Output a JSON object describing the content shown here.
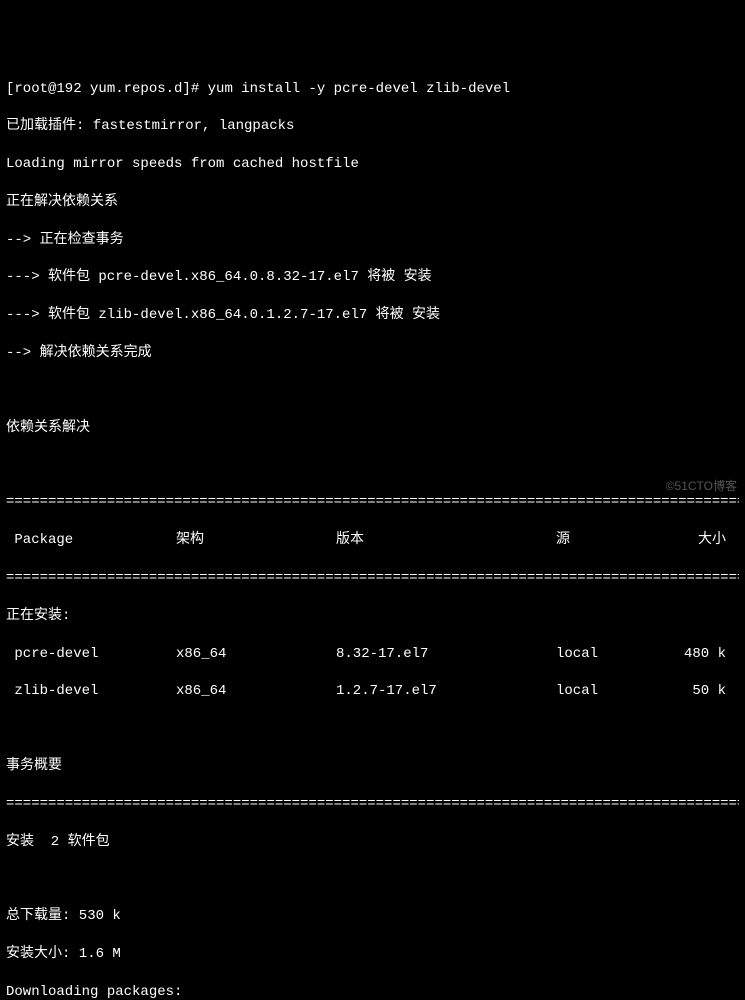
{
  "prompt": {
    "user_host": "[root@192 yum.repos.d]#",
    "command": "yum install -y pcre-devel zlib-devel"
  },
  "output": {
    "plugins": "已加载插件: fastestmirror, langpacks",
    "loading": "Loading mirror speeds from cached hostfile",
    "resolving": "正在解决依赖关系",
    "check_tx": "--> 正在检查事务",
    "pkg1": "---> 软件包 pcre-devel.x86_64.0.8.32-17.el7 将被 安装",
    "pkg2": "---> 软件包 zlib-devel.x86_64.0.1.2.7-17.el7 将被 安装",
    "done": "--> 解决依赖关系完成",
    "resolved": "依赖关系解决"
  },
  "divider": "=========================================================================================",
  "headers": {
    "package": " Package",
    "arch": "架构",
    "version": "版本",
    "repo": "源",
    "size": "大小"
  },
  "installing_label": "正在安装:",
  "rows": [
    {
      "package": " pcre-devel",
      "arch": "x86_64",
      "version": "8.32-17.el7",
      "repo": "local",
      "size": "480 k"
    },
    {
      "package": " zlib-devel",
      "arch": "x86_64",
      "version": "1.2.7-17.el7",
      "repo": "local",
      "size": "50 k"
    }
  ],
  "summary": {
    "title": "事务概要",
    "install": "安装  2 软件包",
    "total_download": "总下载量: 530 k",
    "install_size": "安装大小: 1.6 M",
    "downloading": "Downloading packages:"
  },
  "watermark": "©51CTO博客"
}
